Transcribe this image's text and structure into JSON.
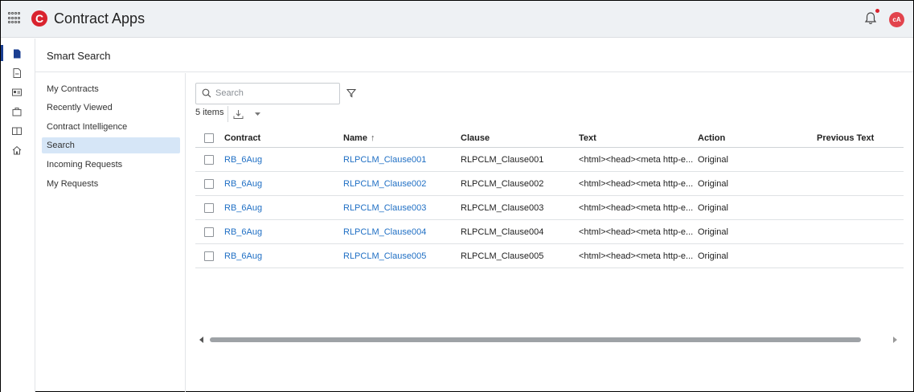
{
  "app": {
    "title": "Contract Apps",
    "logo_letter": "C",
    "avatar_initials": "cA"
  },
  "page": {
    "title": "Smart Search"
  },
  "nav": {
    "items": [
      {
        "label": "My Contracts"
      },
      {
        "label": "Recently Viewed"
      },
      {
        "label": "Contract Intelligence"
      },
      {
        "label": "Search",
        "active": true
      },
      {
        "label": "Incoming Requests"
      },
      {
        "label": "My Requests"
      }
    ]
  },
  "toolbar": {
    "search_placeholder": "Search",
    "items_count": "5 items"
  },
  "table": {
    "columns": [
      "Contract",
      "Name",
      "Clause",
      "Text",
      "Action",
      "Previous Text"
    ],
    "sort_indicator": "↑",
    "rows": [
      {
        "contract": "RB_6Aug",
        "name": "RLPCLM_Clause001",
        "clause": "RLPCLM_Clause001",
        "text": "<html><head><meta http-e...",
        "action": "Original",
        "previous_text": ""
      },
      {
        "contract": "RB_6Aug",
        "name": "RLPCLM_Clause002",
        "clause": "RLPCLM_Clause002",
        "text": "<html><head><meta http-e...",
        "action": "Original",
        "previous_text": ""
      },
      {
        "contract": "RB_6Aug",
        "name": "RLPCLM_Clause003",
        "clause": "RLPCLM_Clause003",
        "text": "<html><head><meta http-e...",
        "action": "Original",
        "previous_text": ""
      },
      {
        "contract": "RB_6Aug",
        "name": "RLPCLM_Clause004",
        "clause": "RLPCLM_Clause004",
        "text": "<html><head><meta http-e...",
        "action": "Original",
        "previous_text": ""
      },
      {
        "contract": "RB_6Aug",
        "name": "RLPCLM_Clause005",
        "clause": "RLPCLM_Clause005",
        "text": "<html><head><meta http-e...",
        "action": "Original",
        "previous_text": ""
      }
    ]
  },
  "colors": {
    "brand": "#d9232e",
    "link": "#1f6fc4",
    "nav_active": "#d6e6f7",
    "rail_active": "#1a3e91"
  },
  "icons": [
    "app-launcher-icon",
    "notification-bell-icon",
    "document-icon",
    "file-icon",
    "id-card-icon",
    "briefcase-icon",
    "book-icon",
    "home-icon",
    "search-icon",
    "filter-icon",
    "export-icon",
    "chevron-down-icon"
  ]
}
